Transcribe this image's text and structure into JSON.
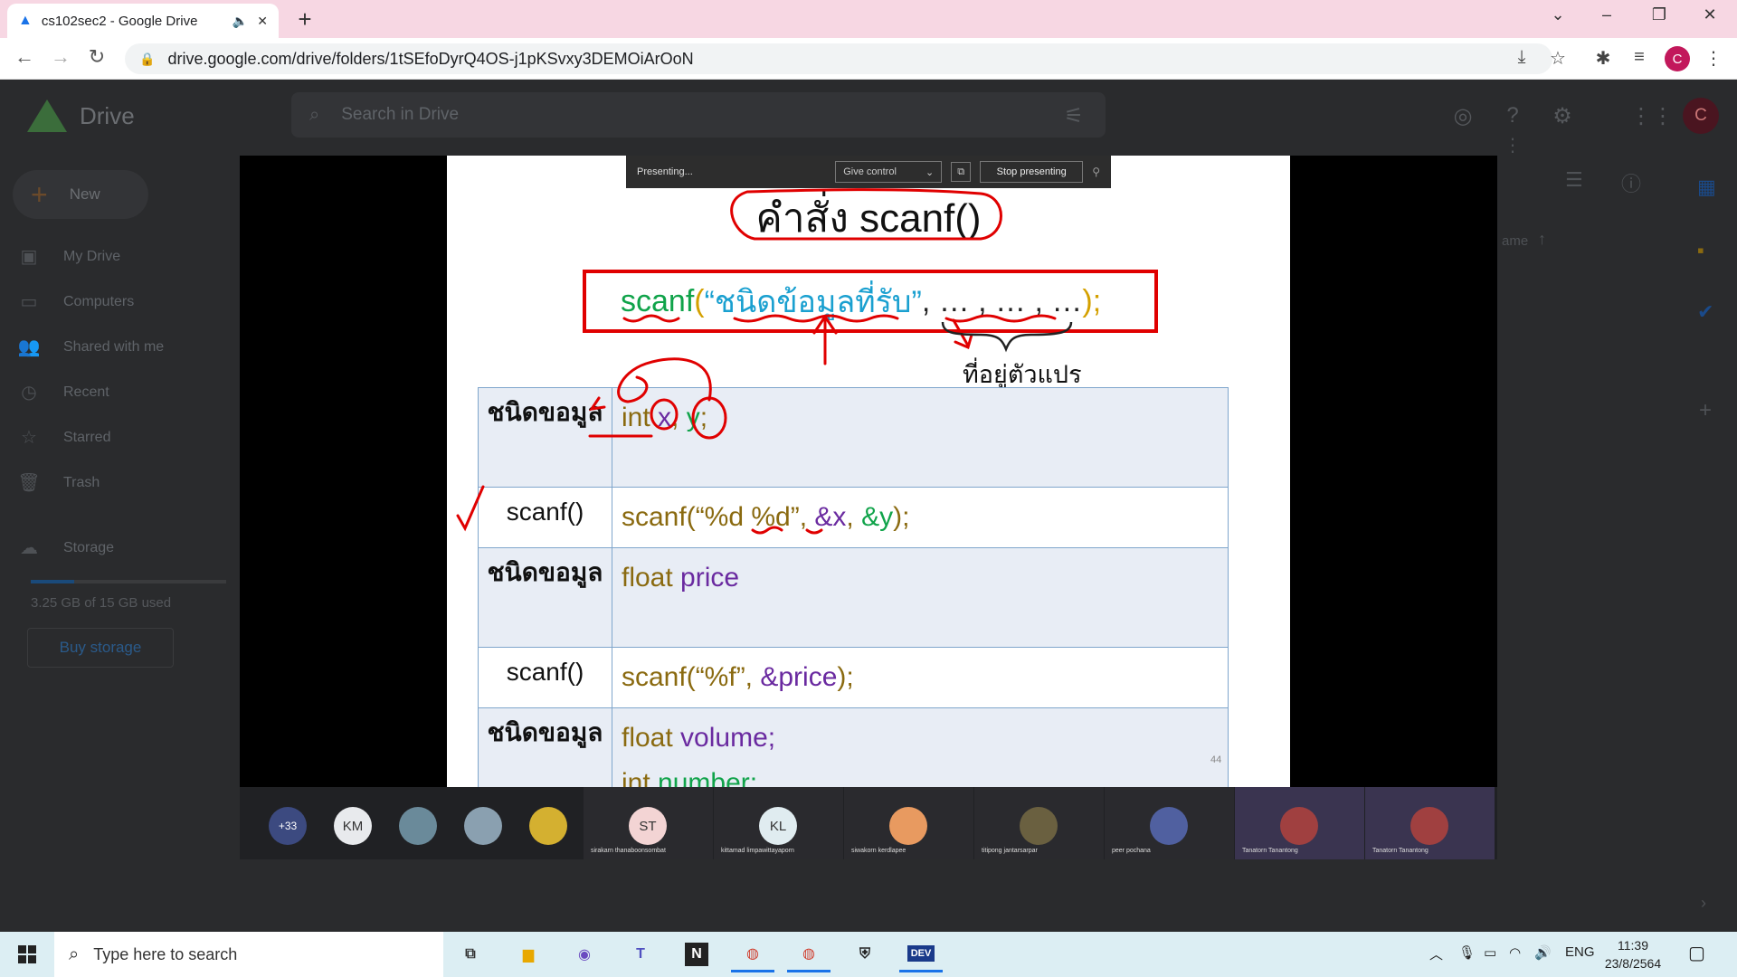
{
  "browser": {
    "tab_title": "cs102sec2 - Google Drive",
    "url": "drive.google.com/drive/folders/1tSEfoDyrQ4OS-j1pKSvxy3DEMOiArOoN",
    "profile_initial": "C"
  },
  "drive": {
    "logo_text": "Drive",
    "search_placeholder": "Search in Drive",
    "new_label": "New",
    "avatar_initial": "C",
    "nav": [
      {
        "label": "My Drive",
        "icon": "my-drive-icon"
      },
      {
        "label": "Computers",
        "icon": "computers-icon"
      },
      {
        "label": "Shared with me",
        "icon": "shared-icon"
      },
      {
        "label": "Recent",
        "icon": "clock-icon"
      },
      {
        "label": "Starred",
        "icon": "star-icon"
      },
      {
        "label": "Trash",
        "icon": "trash-icon"
      }
    ],
    "storage_label": "Storage",
    "storage_used": "3.25 GB of 15 GB used",
    "storage_fraction": 0.22,
    "buy_storage_label": "Buy storage",
    "sort_label": "ame"
  },
  "presentation_bar": {
    "status": "Presenting...",
    "give_control": "Give control",
    "stop_presenting": "Stop presenting"
  },
  "slide": {
    "title": "คำสั่ง scanf()",
    "syntax_fn": "scanf",
    "syntax_open": "(",
    "syntax_string": " “ชนิดข้อมูลที่รับ”",
    "syntax_args": " , … , … , … ",
    "syntax_close": ");",
    "var_label": "ที่อยู่ตัวแปร",
    "page_number": "44",
    "rows": [
      {
        "key": "ชนิดขอมูล",
        "parts": [
          [
            "int ",
            "brn"
          ],
          [
            "x",
            "pur"
          ],
          [
            ", ",
            "brn"
          ],
          [
            "y",
            "grn"
          ],
          [
            ";",
            "brn"
          ]
        ]
      },
      {
        "key": "scanf()",
        "parts": [
          [
            "scanf(“%d %d”, ",
            "brn"
          ],
          [
            "&x",
            "pur"
          ],
          [
            ", ",
            "brn"
          ],
          [
            "&y",
            "grn"
          ],
          [
            ");",
            "brn"
          ]
        ]
      },
      {
        "key": "ชนิดขอมูล",
        "parts": [
          [
            "float ",
            "brn"
          ],
          [
            "price",
            "pur"
          ]
        ]
      },
      {
        "key": "scanf()",
        "parts": [
          [
            "scanf(“%f”, ",
            "brn"
          ],
          [
            "&price",
            "pur"
          ],
          [
            ");",
            "brn"
          ]
        ]
      },
      {
        "key": "ชนิดขอมูล",
        "parts": [
          [
            "float ",
            "brn"
          ],
          [
            "volume;",
            "pur"
          ],
          [
            "\n",
            "brn"
          ],
          [
            "int ",
            "brn"
          ],
          [
            "number;",
            "grn"
          ]
        ]
      }
    ]
  },
  "participants": {
    "overflow": "+33",
    "circles": [
      {
        "initials": "KM",
        "bg": "#e8eaed",
        "fg": "#333"
      },
      {
        "initials": "",
        "bg": "#6a8a9a",
        "fg": "#fff"
      },
      {
        "initials": "",
        "bg": "#8aa0b0",
        "fg": "#fff"
      },
      {
        "initials": "",
        "bg": "#d4b030",
        "fg": "#fff"
      }
    ],
    "tiles": [
      {
        "name": "sirakarn thanaboonsombat",
        "initials": "ST",
        "bg": "#f3d4d4",
        "fg": "#333"
      },
      {
        "name": "kittamad limpawittayaporn",
        "initials": "KL",
        "bg": "#e0ecf0",
        "fg": "#333"
      },
      {
        "name": "siwakorn kerdlapee",
        "initials": "",
        "bg": "#e89a60",
        "fg": "#fff"
      },
      {
        "name": "titipong jantarsarpar",
        "initials": "",
        "bg": "#6a6040",
        "fg": "#fff"
      },
      {
        "name": "peer pochana",
        "initials": "",
        "bg": "#5060a0",
        "fg": "#fff"
      },
      {
        "name": "Tanatorn Tanantong",
        "initials": "",
        "bg": "#a04040",
        "fg": "#fff"
      },
      {
        "name": "Tanatorn Tanantong",
        "initials": "",
        "bg": "#a04040",
        "fg": "#fff"
      }
    ]
  },
  "taskbar": {
    "search_placeholder": "Type here to search",
    "language": "ENG",
    "time": "11:39",
    "date": "23/8/2564"
  }
}
